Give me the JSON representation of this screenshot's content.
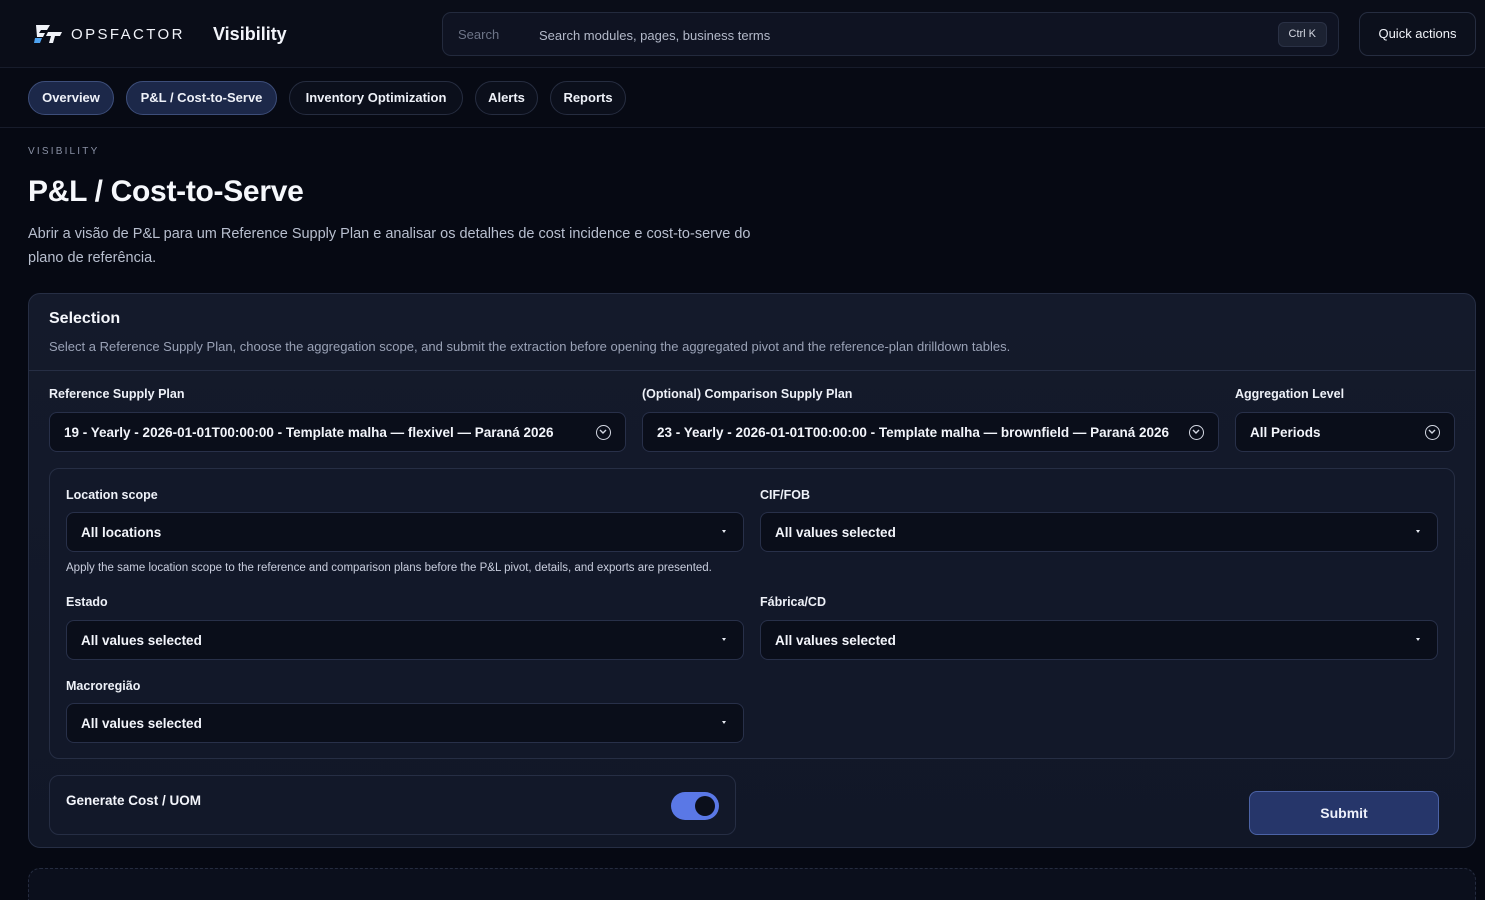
{
  "header": {
    "brand": "OPSFACTOR",
    "app_title": "Visibility",
    "search_label": "Search",
    "search_hint": "Search modules, pages, business terms",
    "shortcut": "Ctrl K",
    "quick_actions": "Quick actions"
  },
  "nav": {
    "tabs": [
      {
        "label": "Overview",
        "active": true
      },
      {
        "label": "P&L / Cost-to-Serve",
        "active": true
      },
      {
        "label": "Inventory Optimization",
        "active": false
      },
      {
        "label": "Alerts",
        "active": false
      },
      {
        "label": "Reports",
        "active": false
      }
    ]
  },
  "page": {
    "eyebrow": "VISIBILITY",
    "title": "P&L / Cost-to-Serve",
    "description": "Abrir a visão de P&L para um Reference Supply Plan e analisar os detalhes de cost incidence e cost-to-serve do plano de referência."
  },
  "selection": {
    "title": "Selection",
    "subtitle": "Select a Reference Supply Plan, choose the aggregation scope, and submit the extraction before opening the aggregated pivot and the reference-plan drilldown tables.",
    "reference_label": "Reference Supply Plan",
    "reference_value": "19 - Yearly - 2026-01-01T00:00:00 - Template malha — flexivel — Paraná 2026",
    "comparison_label": "(Optional) Comparison Supply Plan",
    "comparison_value": "23 - Yearly - 2026-01-01T00:00:00 - Template malha — brownfield — Paraná 2026",
    "aggregation_label": "Aggregation Level",
    "aggregation_value": "All Periods",
    "filters": {
      "location_label": "Location scope",
      "location_value": "All locations",
      "location_helper": "Apply the same location scope to the reference and comparison plans before the P&L pivot, details, and exports are presented.",
      "cif_label": "CIF/FOB",
      "cif_value": "All values selected",
      "estado_label": "Estado",
      "estado_value": "All values selected",
      "fabrica_label": "Fábrica/CD",
      "fabrica_value": "All values selected",
      "macro_label": "Macroregião",
      "macro_value": "All values selected"
    },
    "toggle_label": "Generate Cost / UOM",
    "toggle_on": true,
    "submit_label": "Submit"
  },
  "colors": {
    "accent": "#5a78e6",
    "background": "#060913",
    "card": "#141a2b"
  }
}
